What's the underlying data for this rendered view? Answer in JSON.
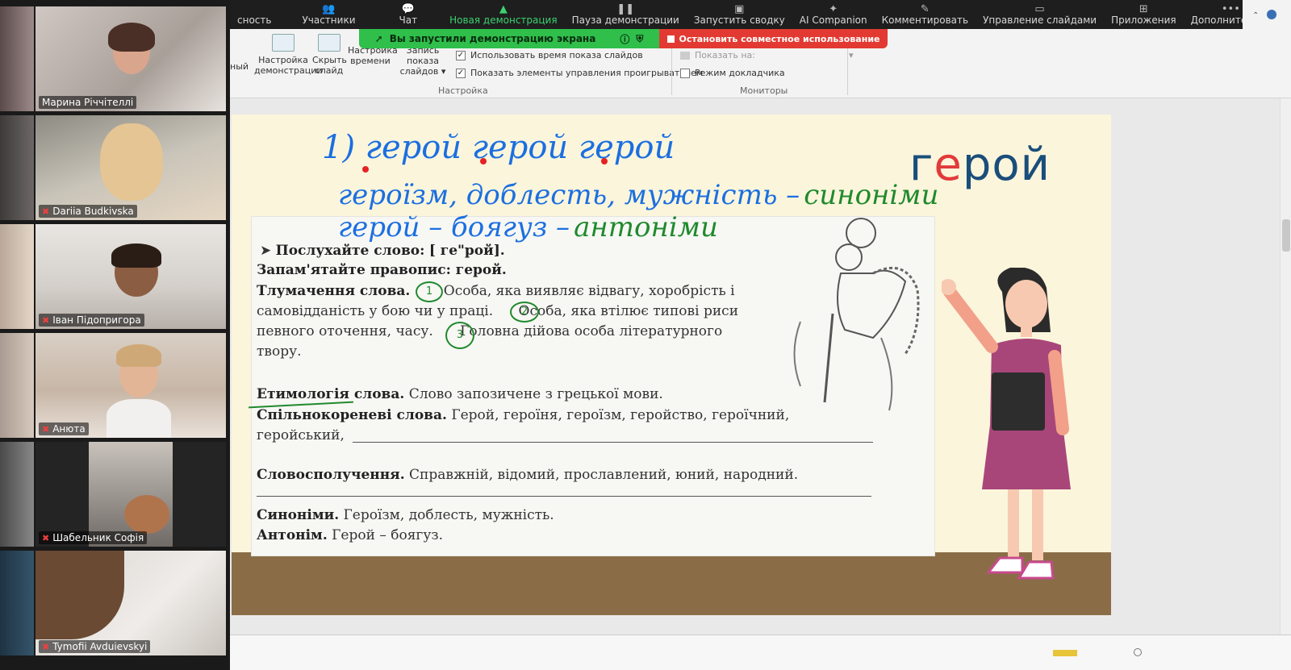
{
  "gallery": {
    "participants": [
      {
        "name": "Марина Річчітеллі",
        "muted": false,
        "active": true
      },
      {
        "name": "Dariia Budkivska",
        "muted": true,
        "active": false
      },
      {
        "name": "Іван Підопригора",
        "muted": true,
        "active": false
      },
      {
        "name": "Анюта",
        "muted": true,
        "active": false
      },
      {
        "name": "Шабельник Софія",
        "muted": true,
        "active": false
      },
      {
        "name": "Tymofii Avduievskyi",
        "muted": true,
        "active": false
      }
    ]
  },
  "zoom_toolbar": {
    "items": [
      {
        "label": "сность",
        "icon": "shield-icon",
        "highlight": false
      },
      {
        "label": "Участники",
        "icon": "people-icon",
        "highlight": false
      },
      {
        "label": "Чат",
        "icon": "chat-icon",
        "highlight": false
      },
      {
        "label": "Новая демонстрация",
        "icon": "share-screen-icon",
        "highlight": true
      },
      {
        "label": "Пауза демонстрации",
        "icon": "pause-icon",
        "highlight": false
      },
      {
        "label": "Запустить сводку",
        "icon": "summary-icon",
        "highlight": false
      },
      {
        "label": "AI Companion",
        "icon": "sparkle-icon",
        "highlight": false
      },
      {
        "label": "Комментировать",
        "icon": "pen-icon",
        "highlight": false
      },
      {
        "label": "Управление слайдами",
        "icon": "slides-icon",
        "highlight": false
      },
      {
        "label": "Приложения",
        "icon": "apps-icon",
        "highlight": false
      },
      {
        "label": "Дополнительно",
        "icon": "more-icon",
        "highlight": false
      }
    ]
  },
  "share_banner": {
    "text": "Вы запустили демонстрацию экрана",
    "stop_label": "Остановить совместное использование",
    "green": "#2fbf4a",
    "red": "#e23a32"
  },
  "ribbon": {
    "cut_label": "ный",
    "setup_show_label": "Настройка демонстрации",
    "hide_slide_label": "Скрыть слайд",
    "rehearse_label": "Настройка времени",
    "record_label": "Запись показа слайдов",
    "use_timings_label": "Использовать время показа слайдов",
    "show_controls_label": "Показать элементы управления проигрывателем",
    "group_setup_label": "Настройка",
    "show_on_label": "Показать на:",
    "presenter_view_label": "Режим докладчика",
    "group_monitors_label": "Мониторы"
  },
  "slide": {
    "big_word_pre": "г",
    "big_word_hl": "е",
    "big_word_post": "рой",
    "handwriting": {
      "line1": "1) герой   герой   герой",
      "line2_blue": "героїзм, доблесть, мужність –",
      "line2_green": "синоніми",
      "line3_blue": "герой – боягуз –",
      "line3_green": "антоніми"
    },
    "book": {
      "listen_prefix": "Послухайте слово:",
      "listen_word": "[ ге\"рой].",
      "remember": "Запам'ятайте правопис: герой.",
      "meaning_title": "Тлумачення слова.",
      "meaning_1": "Особа, яка виявляє відвагу, хоробрість і",
      "meaning_2a": "самовідданість у бою чи у праці.",
      "meaning_2b": "Особа, яка втілює типові риси",
      "meaning_3a": "певного оточення, часу.",
      "meaning_3b": "Головна дійова особа літературного",
      "meaning_4": "твору.",
      "etym_title": "Етимологія слова.",
      "etym_text": "Слово запозичене з грецької мови.",
      "cognate_title": "Спільнокореневі слова.",
      "cognate_text": "Герой, героїня, героїзм, геройство, героїчний,",
      "cognate_text2": "геройський,",
      "phrases_title": "Словосполучення.",
      "phrases_text": "Справжній, відомий, прославлений, юний, народний.",
      "syn_title": "Синоніми.",
      "syn_text": "Героїзм, доблесть, мужність.",
      "ant_title": "Антонім.",
      "ant_text": "Герой – боягуз.",
      "circle_1": "1",
      "circle_2": "2",
      "circle_3": "3"
    }
  }
}
